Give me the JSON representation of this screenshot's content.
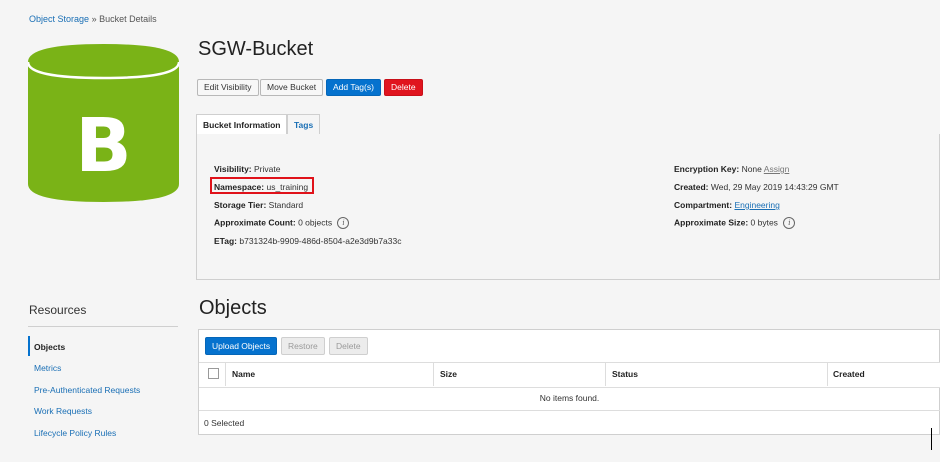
{
  "breadcrumb": {
    "root": "Object Storage",
    "separator": "»",
    "current": "Bucket Details"
  },
  "bucket": {
    "logo_letter": "B",
    "logo_color": "#7ab317",
    "name": "SGW-Bucket"
  },
  "actions": {
    "edit_visibility": "Edit Visibility",
    "move_bucket": "Move Bucket",
    "add_tags": "Add Tag(s)",
    "delete": "Delete"
  },
  "tabs": {
    "bucket_information": "Bucket Information",
    "tags": "Tags"
  },
  "info": {
    "visibility_label": "Visibility:",
    "visibility_value": "Private",
    "namespace_label": "Namespace:",
    "namespace_value": "us_training",
    "storage_tier_label": "Storage Tier:",
    "storage_tier_value": "Standard",
    "approx_count_label": "Approximate Count:",
    "approx_count_value": "0 objects",
    "etag_label": "ETag:",
    "etag_value": "b731324b-9909-486d-8504-a2e3d9b7a33c",
    "encryption_key_label": "Encryption Key:",
    "encryption_key_value": "None",
    "assign_link": "Assign",
    "created_label": "Created:",
    "created_value": "Wed, 29 May 2019 14:43:29 GMT",
    "compartment_label": "Compartment:",
    "compartment_value": "Engineering",
    "approx_size_label": "Approximate Size:",
    "approx_size_value": "0 bytes",
    "info_icon": "i"
  },
  "resources": {
    "title": "Resources",
    "items": [
      {
        "label": "Objects"
      },
      {
        "label": "Metrics"
      },
      {
        "label": "Pre-Authenticated Requests"
      },
      {
        "label": "Work Requests"
      },
      {
        "label": "Lifecycle Policy Rules"
      }
    ]
  },
  "objects": {
    "title": "Objects",
    "upload_button": "Upload Objects",
    "restore_button": "Restore",
    "delete_button": "Delete",
    "columns": [
      "Name",
      "Size",
      "Status",
      "Created"
    ],
    "empty_message": "No items found.",
    "selected_count": "0 Selected"
  },
  "colors": {
    "accent": "#0572ce",
    "danger": "#e0141e",
    "highlight": "#e0121a"
  }
}
